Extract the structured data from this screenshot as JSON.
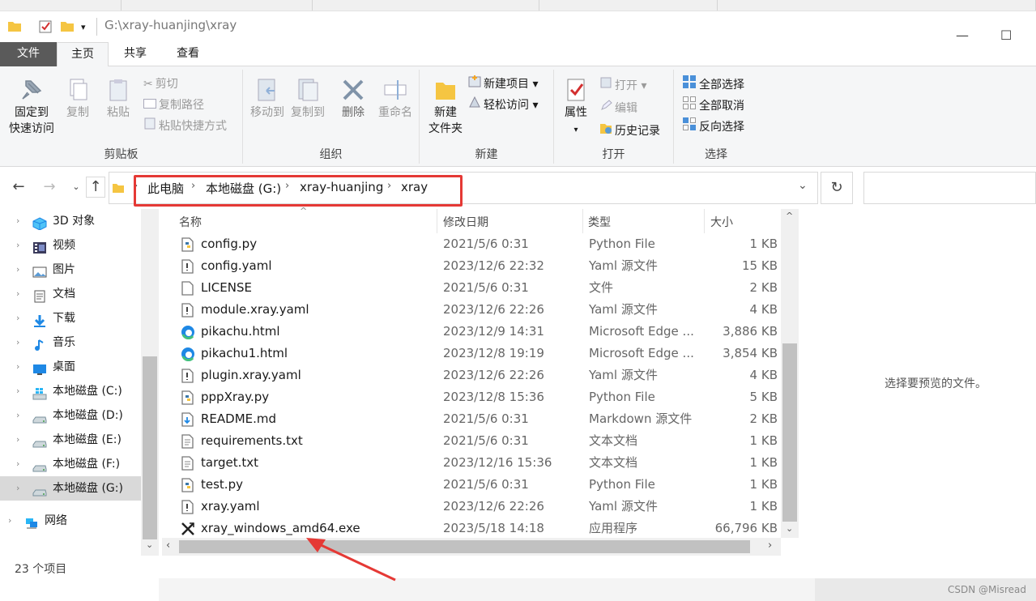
{
  "window": {
    "title": "G:\\xray-huanjing\\xray",
    "minimize_glyph": "—",
    "maximize_glyph": "☐"
  },
  "qat": {
    "dropdown_glyph": "▾"
  },
  "tabs": [
    {
      "label": "文件"
    },
    {
      "label": "主页"
    },
    {
      "label": "共享"
    },
    {
      "label": "查看"
    }
  ],
  "ribbon": {
    "clipboard": {
      "group": "剪贴板",
      "pin_l1": "固定到",
      "pin_l2": "快速访问",
      "copy": "复制",
      "paste": "粘贴",
      "cut": "剪切",
      "copy_path": "复制路径",
      "paste_shortcut": "粘贴快捷方式"
    },
    "organize": {
      "group": "组织",
      "move_to": "移动到",
      "copy_to": "复制到",
      "delete": "删除",
      "rename": "重命名"
    },
    "new": {
      "group": "新建",
      "new_folder_l1": "新建",
      "new_folder_l2": "文件夹",
      "new_item": "新建项目",
      "easy_access": "轻松访问"
    },
    "open": {
      "group": "打开",
      "properties": "属性",
      "open": "打开",
      "edit": "编辑",
      "history": "历史记录"
    },
    "select": {
      "group": "选择",
      "select_all": "全部选择",
      "select_none": "全部取消",
      "invert": "反向选择"
    }
  },
  "address": {
    "crumbs": [
      "此电脑",
      "本地磁盘 (G:)",
      "xray-huanjing",
      "xray"
    ],
    "highlight_color": "#e53935"
  },
  "nav_items": [
    {
      "label": "3D 对象",
      "icon": "3d-objects-icon"
    },
    {
      "label": "视频",
      "icon": "video-icon"
    },
    {
      "label": "图片",
      "icon": "pictures-icon"
    },
    {
      "label": "文档",
      "icon": "documents-icon"
    },
    {
      "label": "下载",
      "icon": "download-icon"
    },
    {
      "label": "音乐",
      "icon": "music-icon"
    },
    {
      "label": "桌面",
      "icon": "desktop-icon"
    },
    {
      "label": "本地磁盘 (C:)",
      "icon": "windows-drive-icon"
    },
    {
      "label": "本地磁盘 (D:)",
      "icon": "drive-icon"
    },
    {
      "label": "本地磁盘 (E:)",
      "icon": "drive-icon"
    },
    {
      "label": "本地磁盘 (F:)",
      "icon": "drive-icon"
    },
    {
      "label": "本地磁盘 (G:)",
      "icon": "drive-icon",
      "selected": true
    },
    {
      "label": "网络",
      "icon": "network-icon"
    }
  ],
  "columns": {
    "name": "名称",
    "date": "修改日期",
    "type": "类型",
    "size": "大小"
  },
  "files": [
    {
      "name": "config.py",
      "date": "2021/5/6 0:31",
      "type": "Python File",
      "size": "1 KB",
      "icon": "python-file-icon"
    },
    {
      "name": "config.yaml",
      "date": "2023/12/6 22:32",
      "type": "Yaml 源文件",
      "size": "15 KB",
      "icon": "yaml-file-icon"
    },
    {
      "name": "LICENSE",
      "date": "2021/5/6 0:31",
      "type": "文件",
      "size": "2 KB",
      "icon": "blank-file-icon"
    },
    {
      "name": "module.xray.yaml",
      "date": "2023/12/6 22:26",
      "type": "Yaml 源文件",
      "size": "4 KB",
      "icon": "yaml-file-icon"
    },
    {
      "name": "pikachu.html",
      "date": "2023/12/9 14:31",
      "type": "Microsoft Edge ...",
      "size": "3,886 KB",
      "icon": "edge-icon"
    },
    {
      "name": "pikachu1.html",
      "date": "2023/12/8 19:19",
      "type": "Microsoft Edge ...",
      "size": "3,854 KB",
      "icon": "edge-icon"
    },
    {
      "name": "plugin.xray.yaml",
      "date": "2023/12/6 22:26",
      "type": "Yaml 源文件",
      "size": "4 KB",
      "icon": "yaml-file-icon"
    },
    {
      "name": "pppXray.py",
      "date": "2023/12/8 15:36",
      "type": "Python File",
      "size": "5 KB",
      "icon": "python-file-icon"
    },
    {
      "name": "README.md",
      "date": "2021/5/6 0:31",
      "type": "Markdown 源文件",
      "size": "2 KB",
      "icon": "markdown-file-icon"
    },
    {
      "name": "requirements.txt",
      "date": "2021/5/6 0:31",
      "type": "文本文档",
      "size": "1 KB",
      "icon": "text-file-icon"
    },
    {
      "name": "target.txt",
      "date": "2023/12/16 15:36",
      "type": "文本文档",
      "size": "1 KB",
      "icon": "text-file-icon"
    },
    {
      "name": "test.py",
      "date": "2021/5/6 0:31",
      "type": "Python File",
      "size": "1 KB",
      "icon": "python-file-icon"
    },
    {
      "name": "xray.yaml",
      "date": "2023/12/6 22:26",
      "type": "Yaml 源文件",
      "size": "1 KB",
      "icon": "yaml-file-icon"
    },
    {
      "name": "xray_windows_amd64.exe",
      "date": "2023/5/18 14:18",
      "type": "应用程序",
      "size": "66,796 KB",
      "icon": "xray-exe-icon"
    }
  ],
  "preview": {
    "text": "选择要预览的文件。"
  },
  "status": {
    "count": "23 个项目"
  },
  "watermark": "CSDN @Misread",
  "annotation_arrow_color": "#e53935"
}
